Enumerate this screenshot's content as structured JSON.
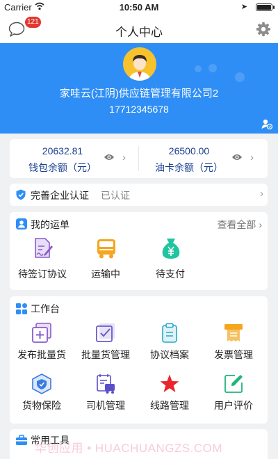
{
  "status_bar": {
    "carrier": "Carrier",
    "time": "10:50 AM"
  },
  "nav": {
    "title": "个人中心",
    "message_badge": "121"
  },
  "profile": {
    "company": "家哇云(江阴)供应链管理有限公司2",
    "phone": "17712345678"
  },
  "wallet": {
    "left": {
      "amount": "20632.81",
      "label": "钱包余额（元）"
    },
    "right": {
      "amount": "26500.00",
      "label": "油卡余额（元）"
    }
  },
  "certification": {
    "label": "完善企业认证",
    "status": "已认证"
  },
  "orders": {
    "title": "我的运单",
    "view_all": "查看全部",
    "items": [
      {
        "label": "待签订协议",
        "icon": "sign-contract-icon"
      },
      {
        "label": "运输中",
        "icon": "truck-icon"
      },
      {
        "label": "待支付",
        "icon": "money-bag-icon"
      }
    ]
  },
  "workbench": {
    "title": "工作台",
    "items": [
      {
        "label": "发布批量货",
        "icon": "publish-cargo-icon"
      },
      {
        "label": "批量货管理",
        "icon": "cargo-manage-icon"
      },
      {
        "label": "协议档案",
        "icon": "agreement-file-icon"
      },
      {
        "label": "发票管理",
        "icon": "invoice-icon"
      },
      {
        "label": "货物保险",
        "icon": "insurance-icon"
      },
      {
        "label": "司机管理",
        "icon": "driver-manage-icon"
      },
      {
        "label": "线路管理",
        "icon": "route-star-icon"
      },
      {
        "label": "用户评价",
        "icon": "review-edit-icon"
      }
    ]
  },
  "tools": {
    "title": "常用工具"
  },
  "watermark": "华创应用 • HUACHUANGZS.COM",
  "colors": {
    "primary": "#2f8ef5",
    "amount_text": "#1a3f8f",
    "badge": "#e3362e",
    "star": "#e8262b",
    "page_bg": "#f0f1f3"
  }
}
